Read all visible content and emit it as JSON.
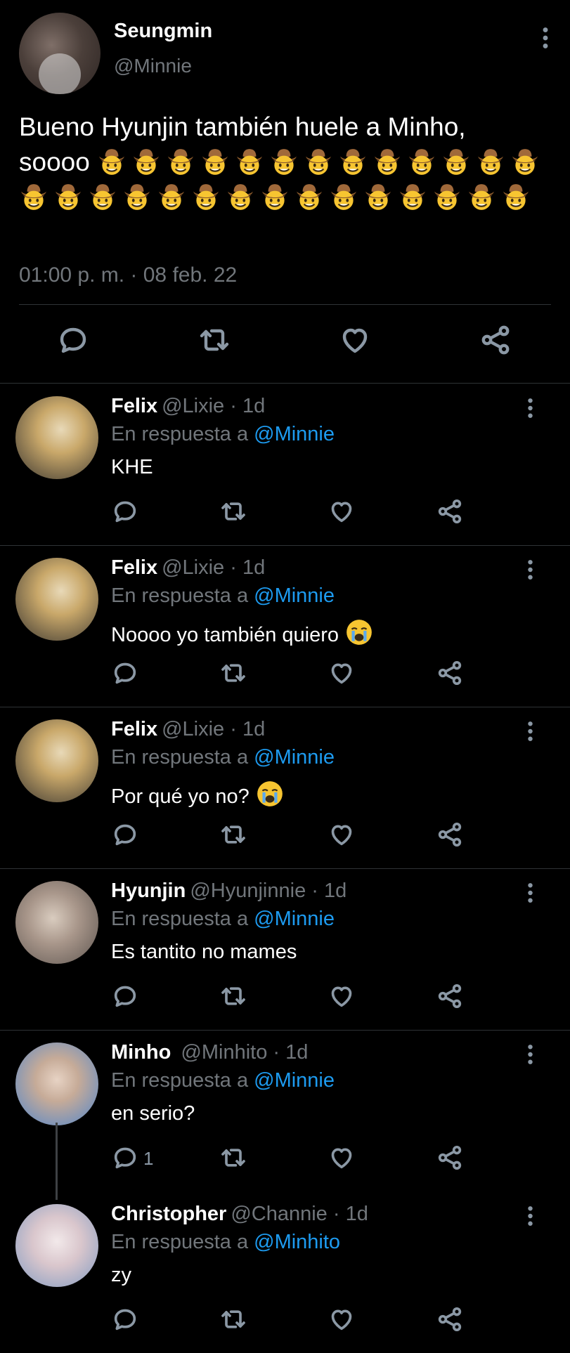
{
  "main_tweet": {
    "name": "Seungmin",
    "handle": "@Minnie",
    "text": "Bueno Hyunjin también huele a Minho,",
    "text2": "soooo",
    "emoji": "cowboy-hat-face-emoji",
    "timestamp": "01:00 p. m. · 08 feb. 22"
  },
  "replies": [
    {
      "name": "Felix",
      "handle": "@Lixie",
      "time": "· 1d",
      "reply_prefix": "En respuesta a",
      "reply_to": "@Minnie",
      "text": "KHE"
    },
    {
      "name": "Felix",
      "handle": "@Lixie",
      "time": "· 1d",
      "reply_prefix": "En respuesta a",
      "reply_to": "@Minnie",
      "text": "Noooo yo también quiero"
    },
    {
      "name": "Felix",
      "handle": "@Lixie",
      "time": "· 1d",
      "reply_prefix": "En respuesta a",
      "reply_to": "@Minnie",
      "text": "Por qué yo no?"
    },
    {
      "name": "Hyunjin",
      "handle": "@Hyunjinnie",
      "time": "· 1d",
      "reply_prefix": "En respuesta a",
      "reply_to": "@Minnie",
      "text": "Es tantito no mames"
    },
    {
      "name": "Minho",
      "handle": "@Minhito",
      "time": "· 1d",
      "reply_prefix": "En respuesta a",
      "reply_to": "@Minnie",
      "text": "en serio?",
      "reply_count": "1"
    },
    {
      "name": "Christopher",
      "handle": "@Channie",
      "time": "· 1d",
      "reply_prefix": "En respuesta a",
      "reply_to": "@Minhito",
      "text": "zy"
    }
  ],
  "colors": {
    "background": "#000000",
    "text": "#e7e9ea",
    "muted": "#71767b",
    "link": "#1d9bf0",
    "divider": "#2f3336"
  }
}
